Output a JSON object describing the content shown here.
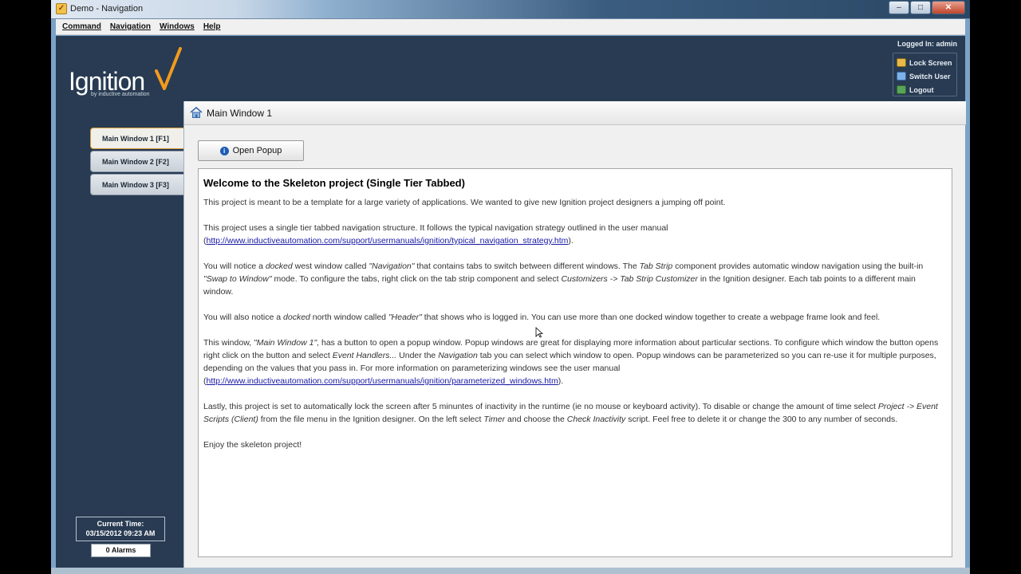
{
  "window": {
    "title": "Demo - Navigation",
    "controls": [
      "–",
      "□",
      "✕"
    ]
  },
  "menubar": [
    "Command",
    "Navigation",
    "Windows",
    "Help"
  ],
  "header": {
    "logo_text": "Ignition",
    "logo_tagline": "by inductive automation",
    "logged_in": "Logged In: admin",
    "user_buttons": [
      {
        "label": "Lock Screen",
        "icon": "lock-icon"
      },
      {
        "label": "Switch User",
        "icon": "switch-user-icon"
      },
      {
        "label": "Logout",
        "icon": "logout-icon"
      }
    ]
  },
  "nav": {
    "tabs": [
      "Main Window 1 [F1]",
      "Main Window 2 [F2]",
      "Main Window 3 [F3]"
    ],
    "active_index": 0,
    "current_time_label": "Current Time:",
    "current_time": "03/15/2012 09:23 AM",
    "alarms": "0 Alarms"
  },
  "main": {
    "title": "Main Window 1",
    "popup_button": "Open Popup",
    "doc": {
      "heading": "Welcome to the Skeleton project (Single Tier Tabbed)",
      "p1": "This project is meant to be a template for a large variety of applications. We wanted to give new Ignition project designers a jumping off point.",
      "p2a": "This project uses a single tier tabbed navigation structure. It follows the typical navigation strategy outlined in the user manual",
      "p2_link": "http://www.inductiveautomation.com/support/usermanuals/ignition/typical_navigation_strategy.htm",
      "p3_1": "You will notice a ",
      "p3_i1": "docked",
      "p3_2": " west window called ",
      "p3_i2": "\"Navigation\"",
      "p3_3": " that contains tabs to switch between different windows. The ",
      "p3_i3": "Tab Strip",
      "p3_4": " component provides automatic window navigation using the built-in ",
      "p3_i4": "\"Swap to Window\"",
      "p3_5": " mode. To configure the tabs, right click on the tab strip component and select ",
      "p3_i5": "Customizers -> Tab Strip Customizer",
      "p3_6": " in the Ignition designer. Each tab points to a different main window.",
      "p4_1": "You will also notice a ",
      "p4_i1": "docked",
      "p4_2": " north window called ",
      "p4_i2": "\"Header\"",
      "p4_3": " that shows who is logged in. You can use more than one docked window together to create a webpage frame look and feel.",
      "p5_1": "This window, ",
      "p5_i1": "\"Main Window 1\"",
      "p5_2": ", has a button to open a popup window. Popup windows are great for displaying more information about particular sections. To configure which window the button opens right click on the button and select ",
      "p5_i2": "Event Handlers...",
      "p5_3": " Under the ",
      "p5_i3": "Navigation",
      "p5_4": " tab you can select which window to open. Popup windows can be parameterized so you can re-use it for multiple purposes, depending on the values that you pass in. For more information on parameterizing windows see the user manual",
      "p5_link": "http://www.inductiveautomation.com/support/usermanuals/ignition/parameterized_windows.htm",
      "p6_1": "Lastly, this project is set to automatically lock the screen after 5 minuntes of inactivity in the runtime (ie no mouse or keyboard activity). To disable or change the amount of time select ",
      "p6_i1": "Project -> Event Scripts (Client)",
      "p6_2": " from the file menu in the Ignition designer. On the left select ",
      "p6_i2": "Timer",
      "p6_3": " and choose the ",
      "p6_i3": "Check Inactivity",
      "p6_4": " script. Feel free to delete it or change the 300 to any number of seconds.",
      "p7": "Enjoy the skeleton project!"
    }
  },
  "colors": {
    "header_bg": "#283b52",
    "accent_orange": "#f29b1d",
    "active_tab_border": "#d49a3a",
    "link": "#1a1aa6"
  }
}
